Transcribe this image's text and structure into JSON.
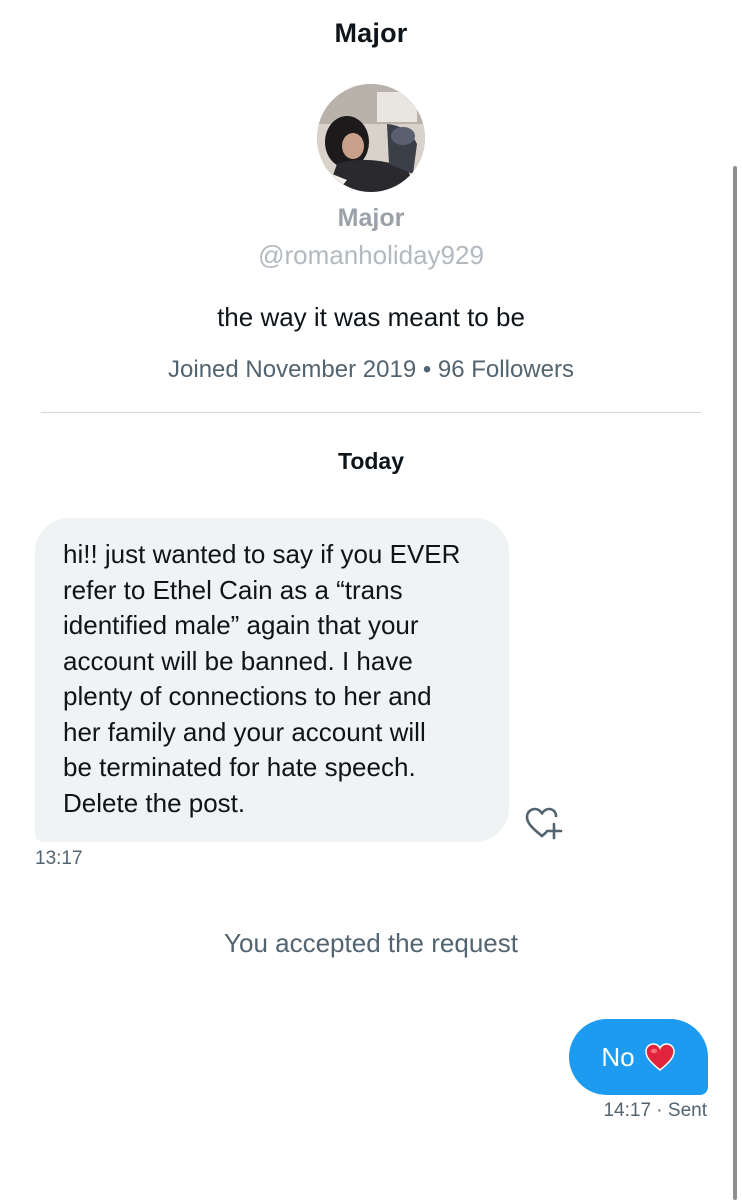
{
  "header": {
    "title": "Major"
  },
  "profile": {
    "name": "Major",
    "handle": "@romanholiday929",
    "bio": "the way it was meant to be",
    "meta": "Joined November 2019 • 96 Followers"
  },
  "conversation": {
    "date_separator": "Today",
    "messages": [
      {
        "direction": "incoming",
        "text": "hi!! just wanted to say if you EVER\nrefer to Ethel Cain as a “trans\nidentified male” again that your\naccount will be banned. I have\nplenty of connections to her and\nher family and your account will\nbe terminated for hate speech.\nDelete the post.",
        "time": "13:17",
        "react_icon": "heart-plus-icon"
      },
      {
        "direction": "system",
        "text": "You accepted the request"
      },
      {
        "direction": "outgoing",
        "text": "No",
        "emoji": "red-heart-emoji",
        "status": "14:17 · Sent"
      }
    ]
  },
  "colors": {
    "outgoing_bubble": "#1d9bf0",
    "incoming_bubble": "#eff3f4",
    "secondary_text": "#536471",
    "primary_text": "#0f1419",
    "heart": "#e0243c"
  }
}
